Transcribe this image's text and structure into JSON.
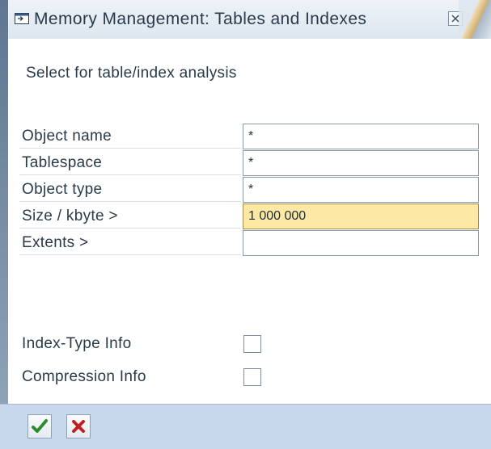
{
  "window": {
    "title": "Memory Management: Tables and Indexes",
    "close_icon": "close-icon"
  },
  "subtitle": "Select for table/index analysis",
  "fields": [
    {
      "label": "Object name",
      "value": "*"
    },
    {
      "label": "Tablespace",
      "value": "*"
    },
    {
      "label": "Object type",
      "value": "*"
    },
    {
      "label": "Size / kbyte >",
      "value": "1 000 000",
      "focused": true
    },
    {
      "label": "Extents >",
      "value": ""
    }
  ],
  "checkboxes": [
    {
      "label": "Index-Type Info",
      "checked": false
    },
    {
      "label": "Compression Info",
      "checked": false
    }
  ],
  "footer": {
    "execute_icon": "checkmark-icon",
    "cancel_icon": "cancel-x-icon"
  },
  "colors": {
    "focused_field": "#fde9a4",
    "footer_bg": "#c7d8ea",
    "execute_green": "#2e8b2e",
    "cancel_red": "#c0201f"
  }
}
